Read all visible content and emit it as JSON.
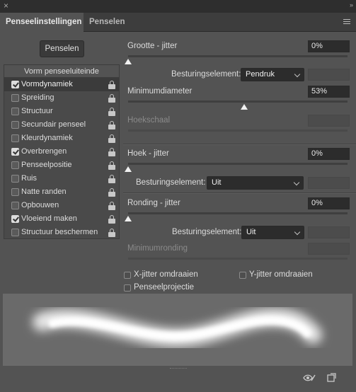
{
  "window": {
    "close_symbol": "×",
    "collapse_symbol": "»"
  },
  "tabs": [
    {
      "label": "Penseelinstellingen",
      "active": true
    },
    {
      "label": "Penselen",
      "active": false
    }
  ],
  "panel_menu_icon": "hamburger-icon",
  "brushes_button": "Penselen",
  "list": {
    "header": "Vorm penseeluiteinde",
    "items": [
      {
        "label": "Vormdynamiek",
        "checked": true,
        "selected": true
      },
      {
        "label": "Spreiding",
        "checked": false
      },
      {
        "label": "Structuur",
        "checked": false
      },
      {
        "label": "Secundair penseel",
        "checked": false
      },
      {
        "label": "Kleurdynamiek",
        "checked": false
      },
      {
        "label": "Overbrengen",
        "checked": true
      },
      {
        "label": "Penseelpositie",
        "checked": false
      },
      {
        "label": "Ruis",
        "checked": false
      },
      {
        "label": "Natte randen",
        "checked": false
      },
      {
        "label": "Opbouwen",
        "checked": false
      },
      {
        "label": "Vloeiend maken",
        "checked": true
      },
      {
        "label": "Structuur beschermen",
        "checked": false
      }
    ]
  },
  "settings": {
    "size_jitter": {
      "label": "Grootte - jitter",
      "value": "0%",
      "slider_fraction": 0
    },
    "size_control": {
      "label": "Besturingselement:",
      "value": "Pendruk"
    },
    "min_diameter": {
      "label": "Minimumdiameter",
      "value": "53%",
      "slider_fraction": 0.53
    },
    "tilt_scale": {
      "label": "Hoekschaal"
    },
    "angle_jitter": {
      "label": "Hoek - jitter",
      "value": "0%",
      "slider_fraction": 0
    },
    "angle_control": {
      "label": "Besturingselement:",
      "value": "Uit"
    },
    "roundness_jitter": {
      "label": "Ronding - jitter",
      "value": "0%",
      "slider_fraction": 0
    },
    "roundness_control": {
      "label": "Besturingselement:",
      "value": "Uit"
    },
    "min_roundness": {
      "label": "Minimumronding"
    },
    "flip_x": {
      "label": "X-jitter omdraaien",
      "checked": false
    },
    "flip_y": {
      "label": "Y-jitter omdraaien",
      "checked": false
    },
    "brush_projection": {
      "label": "Penseelprojectie",
      "checked": false
    }
  },
  "footer": {
    "left_icon": "eye-brush-icon",
    "right_icon": "new-brush-icon"
  }
}
